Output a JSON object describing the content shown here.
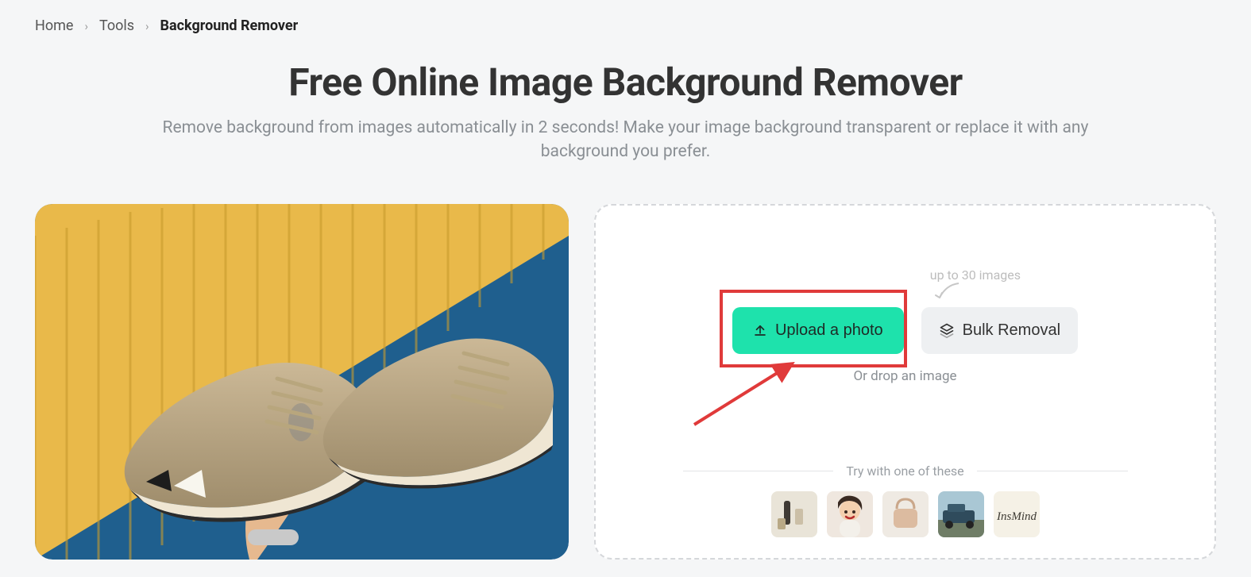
{
  "breadcrumb": {
    "home": "Home",
    "tools": "Tools",
    "current": "Background Remover"
  },
  "hero": {
    "title": "Free Online Image Background Remover",
    "subtitle": "Remove background from images automatically in 2 seconds! Make your image background transparent or replace it with any background you prefer."
  },
  "upload": {
    "hint_top": "up to 30 images",
    "upload_label": "Upload a photo",
    "bulk_label": "Bulk Removal",
    "drop_hint": "Or drop an image",
    "samples_title": "Try with one of these"
  }
}
